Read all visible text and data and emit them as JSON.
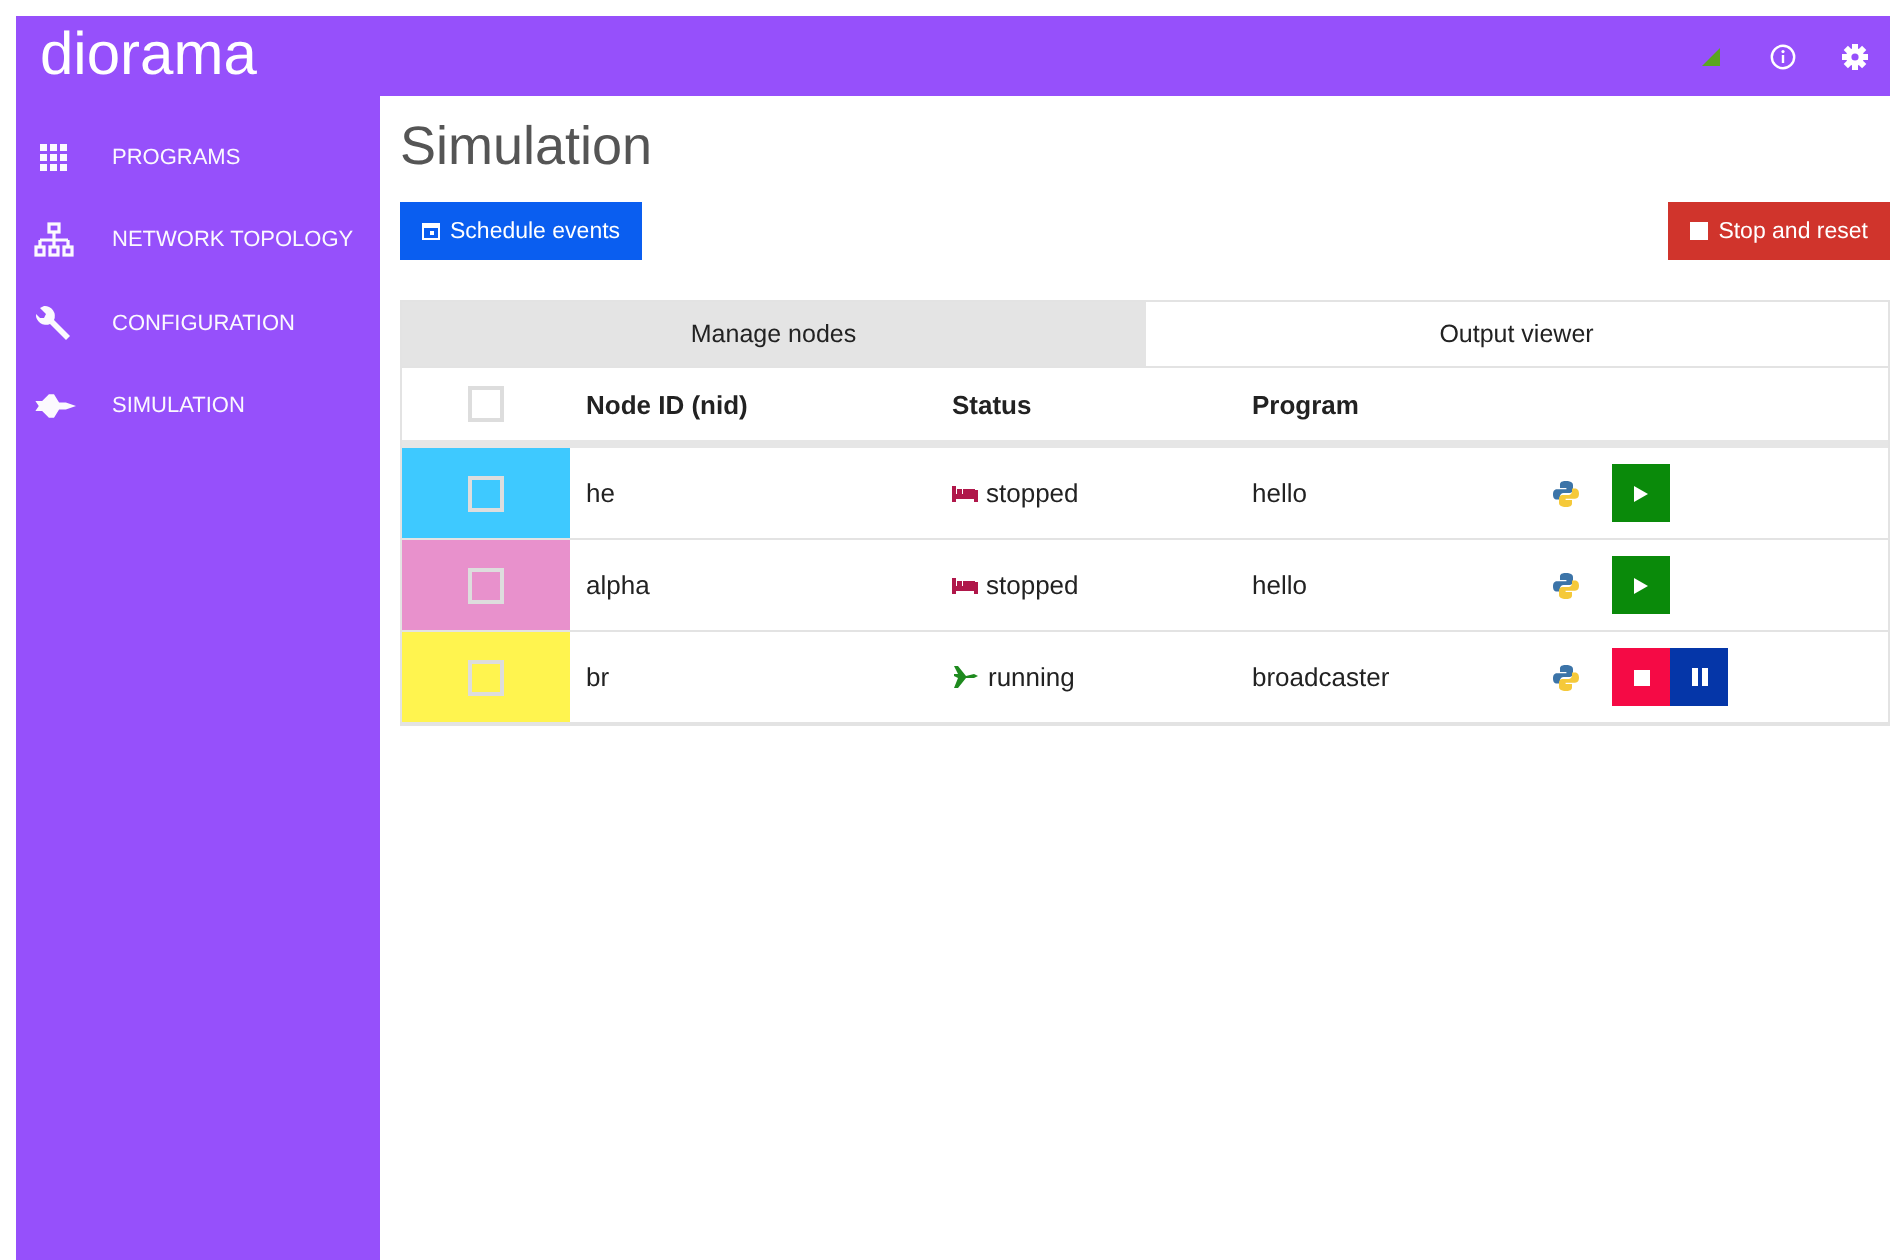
{
  "app": {
    "title": "diorama"
  },
  "sidebar": {
    "items": [
      {
        "label": "PROGRAMS",
        "kind": "grid"
      },
      {
        "label": "NETWORK TOPOLOGY",
        "kind": "tree"
      },
      {
        "label": "CONFIGURATION",
        "kind": "wrench"
      },
      {
        "label": "SIMULATION",
        "kind": "shuttle"
      }
    ]
  },
  "page": {
    "title": "Simulation",
    "schedule_button": "Schedule events",
    "stop_button": "Stop and reset"
  },
  "tabs": [
    {
      "label": "Manage nodes",
      "selected": true
    },
    {
      "label": "Output viewer",
      "selected": false
    }
  ],
  "table": {
    "select_all": {
      "checked": false
    },
    "columns": [
      "Node ID (nid)",
      "Status",
      "Program"
    ],
    "rows": [
      {
        "color": "#3ec9ff",
        "checked": false,
        "nid": "he",
        "status": "stopped",
        "kind": "idle",
        "program": "hello"
      },
      {
        "color": "#e891cc",
        "checked": false,
        "nid": "alpha",
        "status": "stopped",
        "kind": "idle",
        "program": "hello"
      },
      {
        "color": "#fff44f",
        "checked": false,
        "nid": "br",
        "status": "running",
        "kind": "active",
        "program": "broadcaster"
      }
    ]
  }
}
